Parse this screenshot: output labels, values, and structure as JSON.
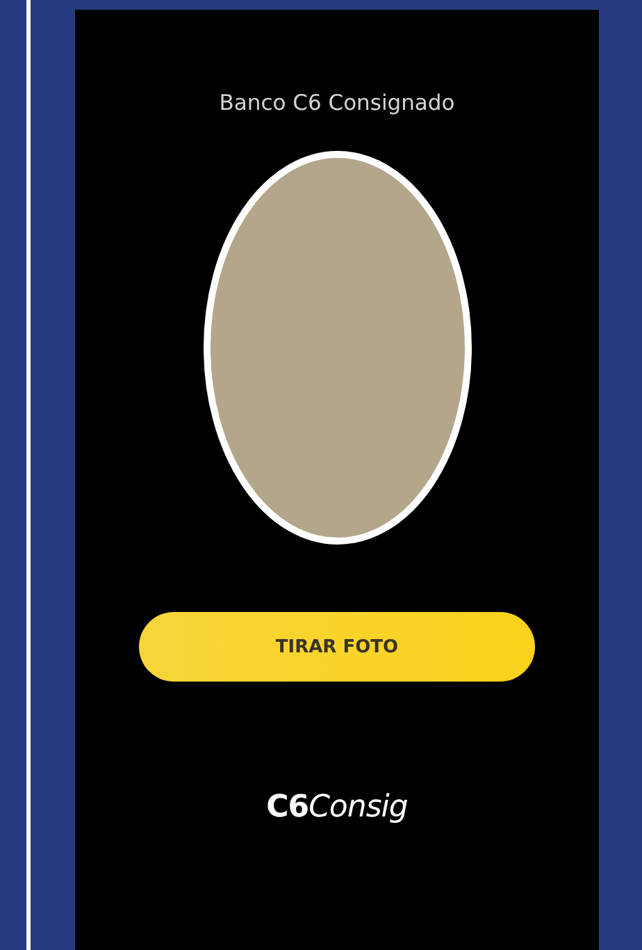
{
  "header": {
    "title": "Banco C6 Consignado"
  },
  "button": {
    "label": "TIRAR FOTO"
  },
  "logo": {
    "text": "**C6**Consig"
  }
}
